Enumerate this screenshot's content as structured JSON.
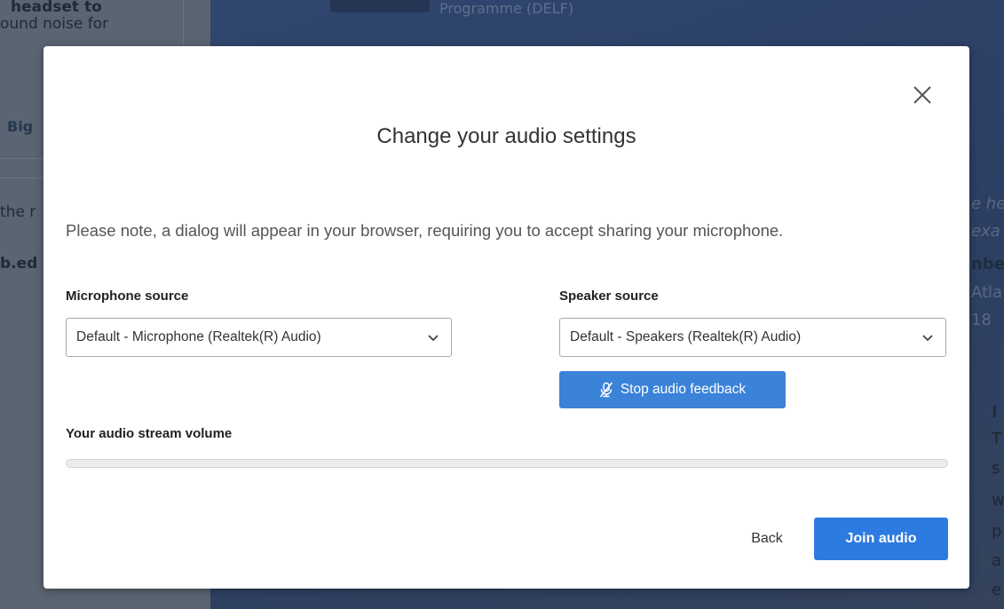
{
  "background": {
    "left_lines": [
      "headset to",
      "ound noise for",
      "Big",
      "the r",
      "b.ed"
    ],
    "top_text": "Programme (DELF)",
    "right_lines": [
      "e he",
      "exa",
      "nbe",
      "Atla",
      "18"
    ],
    "right_lower_lines": [
      "I",
      "T",
      "s",
      "w",
      "p",
      "a",
      "e"
    ]
  },
  "modal": {
    "close_icon": "close-icon",
    "title": "Change your audio settings",
    "note": "Please note, a dialog will appear in your browser, requiring you to accept sharing your microphone.",
    "microphone": {
      "label": "Microphone source",
      "selected": "Default - Microphone (Realtek(R) Audio)"
    },
    "speaker": {
      "label": "Speaker source",
      "selected": "Default - Speakers (Realtek(R) Audio)"
    },
    "feedback_button": {
      "icon": "microphone-off-icon",
      "label": "Stop audio feedback"
    },
    "volume": {
      "label": "Your audio stream volume",
      "level": 0
    },
    "back_label": "Back",
    "join_label": "Join audio"
  },
  "colors": {
    "primary": "#2d7be0",
    "overlay": "#3a4a66"
  }
}
